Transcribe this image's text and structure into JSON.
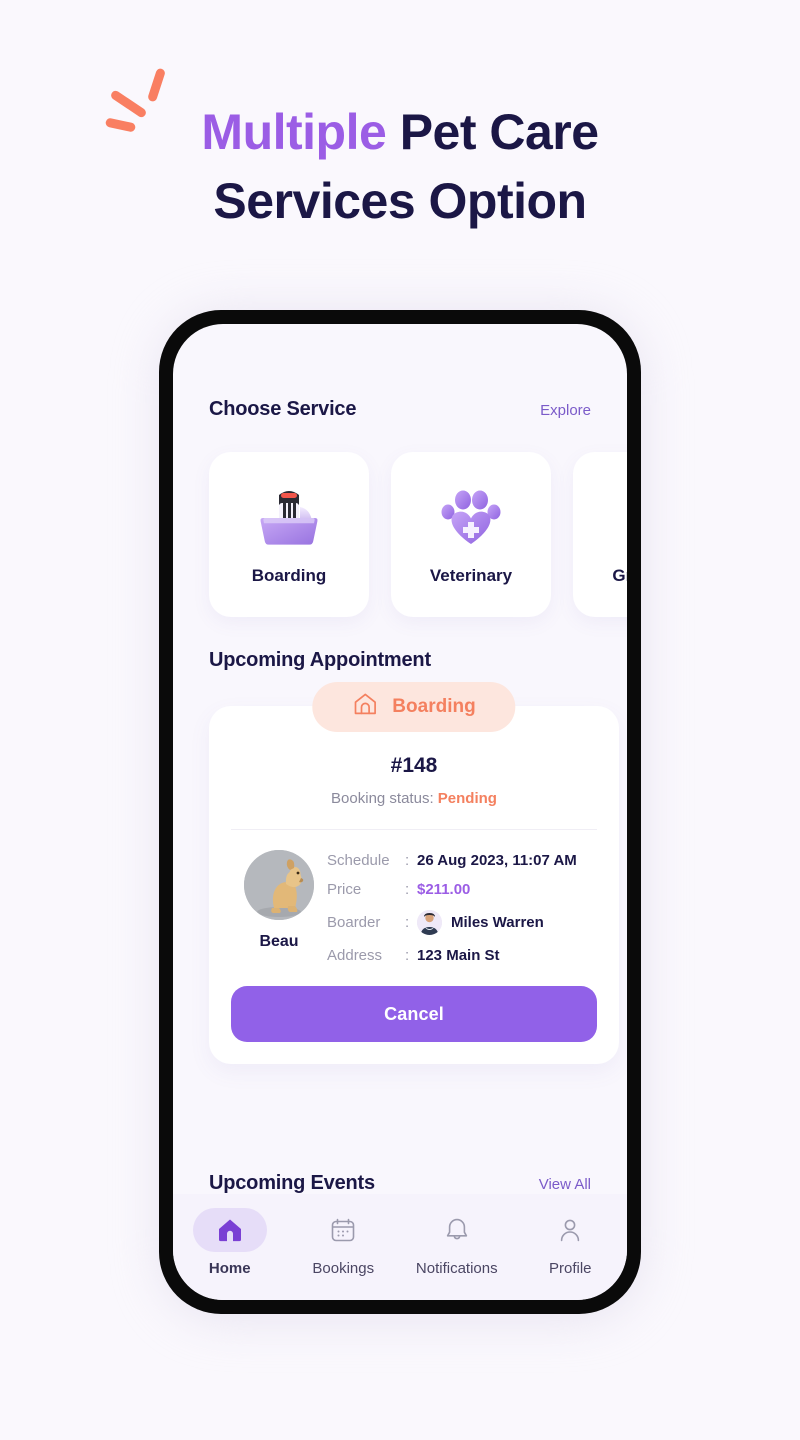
{
  "headline": {
    "accent_word": "Multiple",
    "rest_line1": " Pet Care",
    "line2": "Services Option",
    "accent_color": "#9b5de5",
    "text_color": "#1b1746",
    "spark_color": "#f97f62"
  },
  "screen": {
    "choose_service": {
      "title": "Choose Service",
      "link": "Explore",
      "cards": [
        {
          "label": "Boarding",
          "icon": "pet-carrier-icon"
        },
        {
          "label": "Veterinary",
          "icon": "paw-heart-cross-icon"
        },
        {
          "label": "Grooming",
          "icon": "grooming-icon"
        }
      ]
    },
    "upcoming_appointment": {
      "title": "Upcoming Appointment",
      "badge": {
        "label": "Boarding",
        "icon": "dog-house-icon",
        "bg": "#fde6de",
        "fg": "#f4805f"
      },
      "id": "#148",
      "status_label": "Booking status:",
      "status_value": "Pending",
      "status_color": "#f4805f",
      "pet": {
        "name": "Beau",
        "photo": "golden-retriever-photo"
      },
      "details": [
        {
          "key": "Schedule",
          "sep": ":",
          "value": "26 Aug 2023, 11:07 AM"
        },
        {
          "key": "Price",
          "sep": ":",
          "value": "$211.00"
        },
        {
          "key": "Boarder",
          "sep": ":",
          "value": "Miles Warren"
        },
        {
          "key": "Address",
          "sep": ":",
          "value": "123 Main St"
        }
      ],
      "price_color": "#9b5de5",
      "cancel_label": "Cancel",
      "cancel_color": "#9161e8"
    },
    "upcoming_events": {
      "title": "Upcoming Events",
      "link": "View All"
    },
    "bottom_nav": {
      "items": [
        {
          "label": "Home",
          "icon": "home-icon",
          "active": true
        },
        {
          "label": "Bookings",
          "icon": "calendar-icon",
          "active": false
        },
        {
          "label": "Notifications",
          "icon": "bell-icon",
          "active": false
        },
        {
          "label": "Profile",
          "icon": "person-icon",
          "active": false
        }
      ],
      "active_pill_color": "#e6ddf8",
      "active_icon_color": "#7a3fd4"
    }
  }
}
